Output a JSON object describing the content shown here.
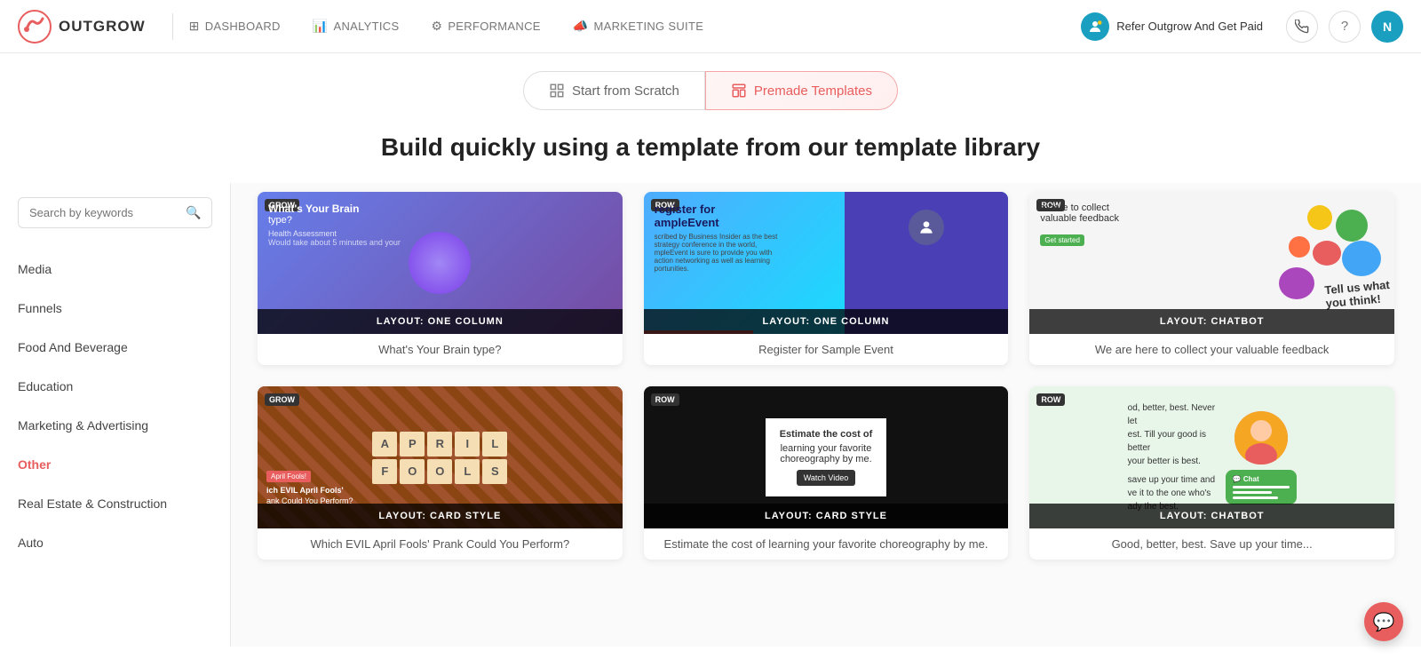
{
  "nav": {
    "logo_text": "OUTGROW",
    "links": [
      {
        "id": "dashboard",
        "label": "DASHBOARD",
        "icon": "⊞"
      },
      {
        "id": "analytics",
        "label": "ANALYTICS",
        "icon": "📊"
      },
      {
        "id": "performance",
        "label": "PERFORMANCE",
        "icon": "⚙"
      },
      {
        "id": "marketing-suite",
        "label": "MARKETING SUITE",
        "icon": "📣"
      }
    ],
    "refer_label": "Refer Outgrow And Get Paid",
    "avatar_label": "N"
  },
  "toggle": {
    "scratch_label": "Start from Scratch",
    "templates_label": "Premade Templates"
  },
  "heading": "Build quickly using a template from our template library",
  "search": {
    "placeholder": "Search by keywords"
  },
  "sidebar_categories": [
    {
      "id": "media",
      "label": "Media",
      "active": false
    },
    {
      "id": "funnels",
      "label": "Funnels",
      "active": false
    },
    {
      "id": "food-beverage",
      "label": "Food And Beverage",
      "active": false
    },
    {
      "id": "education",
      "label": "Education",
      "active": false
    },
    {
      "id": "marketing",
      "label": "Marketing & Advertising",
      "active": false
    },
    {
      "id": "other",
      "label": "Other",
      "active": true
    },
    {
      "id": "real-estate",
      "label": "Real Estate & Construction",
      "active": false
    },
    {
      "id": "auto",
      "label": "Auto",
      "active": false
    }
  ],
  "templates": [
    {
      "id": "brain-type",
      "layout_label": "LAYOUT: ONE COLUMN",
      "title": "What's Your Brain type?",
      "type": "brain"
    },
    {
      "id": "sample-event",
      "layout_label": "LAYOUT: ONE COLUMN",
      "title": "Register for Sample Event",
      "type": "event"
    },
    {
      "id": "feedback",
      "layout_label": "LAYOUT: CHATBOT",
      "title": "We are here to collect your valuable feedback",
      "type": "feedback"
    },
    {
      "id": "april-fools",
      "layout_label": "LAYOUT: CARD STYLE",
      "title": "Which EVIL April Fools' Prank Could You Perform?",
      "type": "april"
    },
    {
      "id": "dance",
      "layout_label": "LAYOUT: CARD STYLE",
      "title": "Estimate the cost of learning your favorite choreography by me.",
      "type": "dance"
    },
    {
      "id": "chatbot2",
      "layout_label": "LAYOUT: CHATBOT",
      "title": "Good, better, best. Save up your time...",
      "type": "chatbot2"
    }
  ]
}
